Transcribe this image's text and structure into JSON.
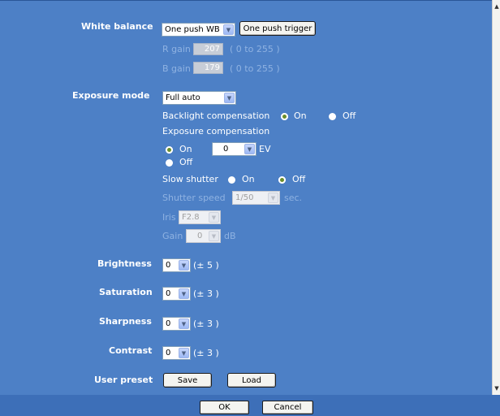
{
  "white_balance": {
    "label": "White balance",
    "mode": "One push WB",
    "trigger_button": "One push trigger",
    "r_gain_label": "R gain",
    "r_gain_value": "207",
    "r_gain_range": "( 0 to 255 )",
    "b_gain_label": "B gain",
    "b_gain_value": "179",
    "b_gain_range": "( 0 to 255 )"
  },
  "exposure": {
    "label": "Exposure mode",
    "mode": "Full auto",
    "backlight_label": "Backlight compensation",
    "backlight_on": "On",
    "backlight_off": "Off",
    "backlight_selected": "On",
    "comp_label": "Exposure compensation",
    "comp_on": "On",
    "comp_off": "Off",
    "comp_selected": "On",
    "comp_value": "0",
    "comp_unit": "EV",
    "slow_shutter_label": "Slow shutter",
    "slow_shutter_on": "On",
    "slow_shutter_off": "Off",
    "slow_shutter_selected": "Off",
    "shutter_speed_label": "Shutter speed",
    "shutter_speed_value": "1/50",
    "shutter_speed_unit": "sec.",
    "iris_label": "Iris",
    "iris_value": "F2.8",
    "gain_label": "Gain",
    "gain_value": "0",
    "gain_unit": "dB"
  },
  "brightness": {
    "label": "Brightness",
    "value": "0",
    "range": "(± 5 )"
  },
  "saturation": {
    "label": "Saturation",
    "value": "0",
    "range": "(± 3 )"
  },
  "sharpness": {
    "label": "Sharpness",
    "value": "0",
    "range": "(± 3 )"
  },
  "contrast": {
    "label": "Contrast",
    "value": "0",
    "range": "(± 3 )"
  },
  "user_preset": {
    "label": "User preset",
    "save": "Save",
    "load": "Load"
  },
  "footer": {
    "ok": "OK",
    "cancel": "Cancel"
  },
  "icons": {
    "dropdown": "chevron-down-icon",
    "scroll_up": "scroll-up-icon",
    "scroll_down": "scroll-down-icon"
  },
  "colors": {
    "background": "#4d80c6",
    "radio_selected": "#6b8e2a"
  }
}
